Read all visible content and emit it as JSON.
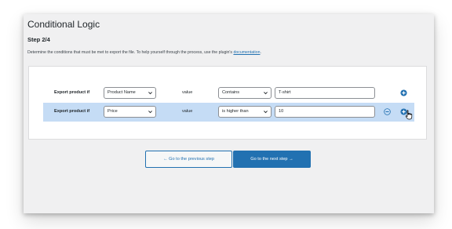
{
  "page": {
    "title": "Conditional Logic",
    "step": "Step 2/4",
    "description": "Determine the conditions that must be met to export the file. To help yourself through the process, use the plugin's",
    "description_link": "documentation",
    "description_end": "."
  },
  "rules": [
    {
      "label": "Export product if",
      "field": "Product Name",
      "value_label": "value",
      "operator": "Contains",
      "value": "T-shirt",
      "highlighted": false
    },
    {
      "label": "Export product if",
      "field": "Price",
      "value_label": "value",
      "operator": "is higher than",
      "value": "10",
      "highlighted": true
    }
  ],
  "buttons": {
    "prev": "← Go to the previous step",
    "next": "Go to the next step →"
  },
  "colors": {
    "accent": "#2271b1",
    "row_highlight": "#c5dcf5",
    "panel_bg": "#f0f0f1"
  },
  "icons": [
    "plus-circle-icon",
    "minus-circle-icon",
    "chevron-down-icon",
    "hand-pointer-icon"
  ]
}
